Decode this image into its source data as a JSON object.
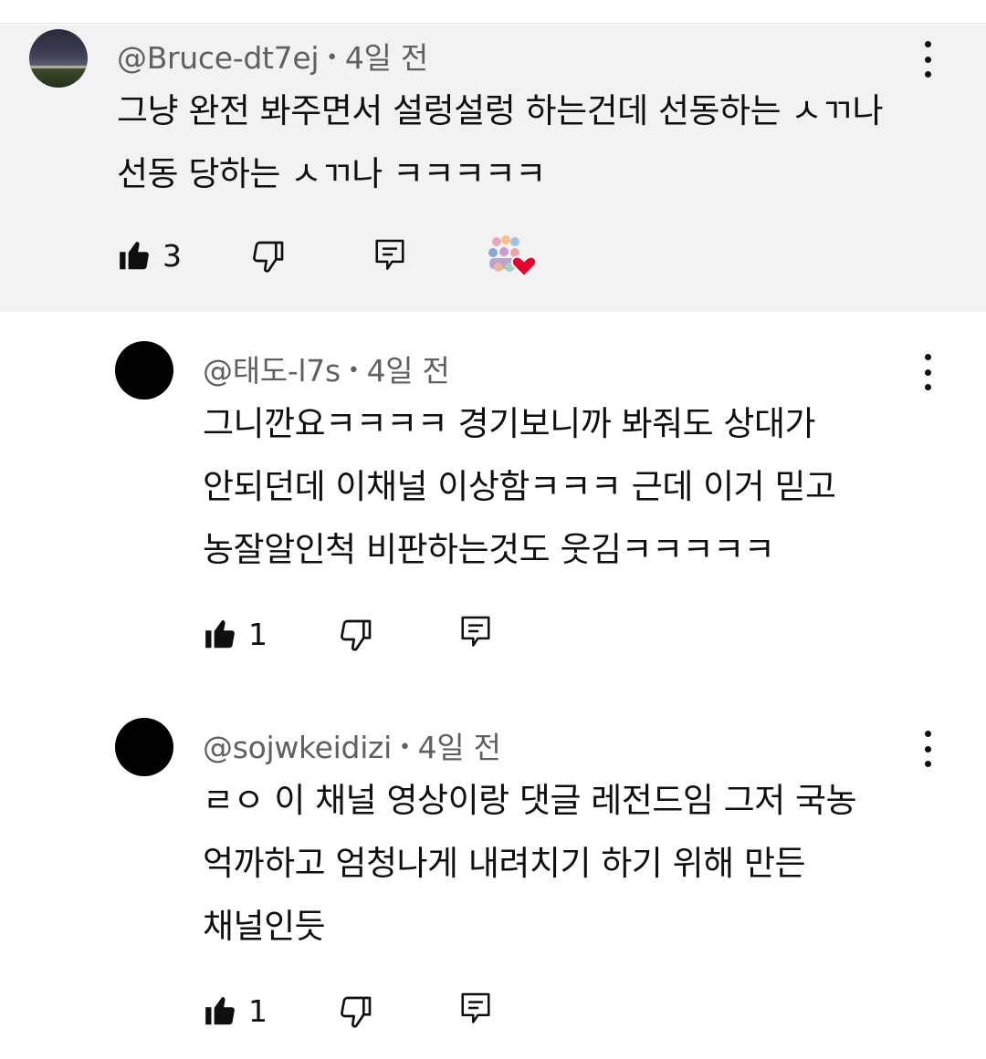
{
  "comments": [
    {
      "handle": "@Bruce-dt7ej",
      "time": "4일 전",
      "text": "그냥 완전 봐주면서 설렁설렁 하는건데 선동하는 ㅅㄲ나\n선동 당하는 ㅅㄲ나 ㅋㅋㅋㅋㅋ",
      "likes": "3",
      "avatar": "photo",
      "creator_heart": true
    },
    {
      "handle": "@태도-l7s",
      "time": "4일 전",
      "text": "그니깐요ㅋㅋㅋㅋ 경기보니까 봐줘도 상대가\n안되던데 이채널 이상함ㅋㅋㅋ 근데 이거 믿고\n농잘알인척 비판하는것도 웃김ㅋㅋㅋㅋㅋ",
      "likes": "1",
      "avatar": "black"
    },
    {
      "handle": "@sojwkeidizi",
      "time": "4일 전",
      "text": "ㄹㅇ 이 채널 영상이랑 댓글 레전드임 그저 국농\n억까하고 엄청나게 내려치기 하기 위해 만든\n채널인듯",
      "likes": "1",
      "avatar": "black"
    }
  ],
  "icons": {
    "like": "thumbs-up-icon",
    "dislike": "thumbs-down-icon",
    "reply": "reply-icon",
    "more": "more-vert-icon",
    "heart": "creator-heart-icon"
  },
  "colors": {
    "highlight_bg": "#f2f2f2",
    "meta_text": "#606060",
    "heart": "#e8002d"
  }
}
